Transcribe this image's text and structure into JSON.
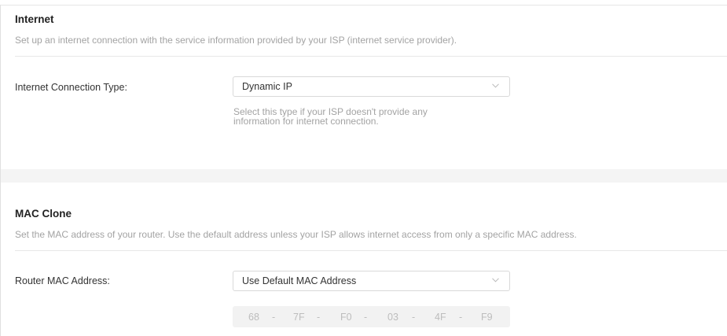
{
  "internet": {
    "title": "Internet",
    "description": "Set up an internet connection with the service information provided by your ISP (internet service provider).",
    "connection_type_label": "Internet Connection Type:",
    "connection_type_value": "Dynamic IP",
    "connection_type_hint_line1": "Select this type if your ISP doesn't provide any",
    "connection_type_hint_line2": "information for internet connection."
  },
  "mac_clone": {
    "title": "MAC Clone",
    "description": "Set the MAC address of your router. Use the default address unless your ISP allows internet access from only a specific MAC address.",
    "router_mac_label": "Router MAC Address:",
    "router_mac_value": "Use Default MAC Address",
    "mac_octets": [
      "68",
      "7F",
      "F0",
      "03",
      "4F",
      "F9"
    ],
    "mac_separator": "-"
  },
  "icons": {
    "dropdown": "chevron-down-icon"
  },
  "colors": {
    "title_text": "#222222",
    "muted_text": "#a3a3a3",
    "border": "#d9d9d9",
    "section_band": "#f4f4f4",
    "disabled_field": "#f2f2f2"
  }
}
